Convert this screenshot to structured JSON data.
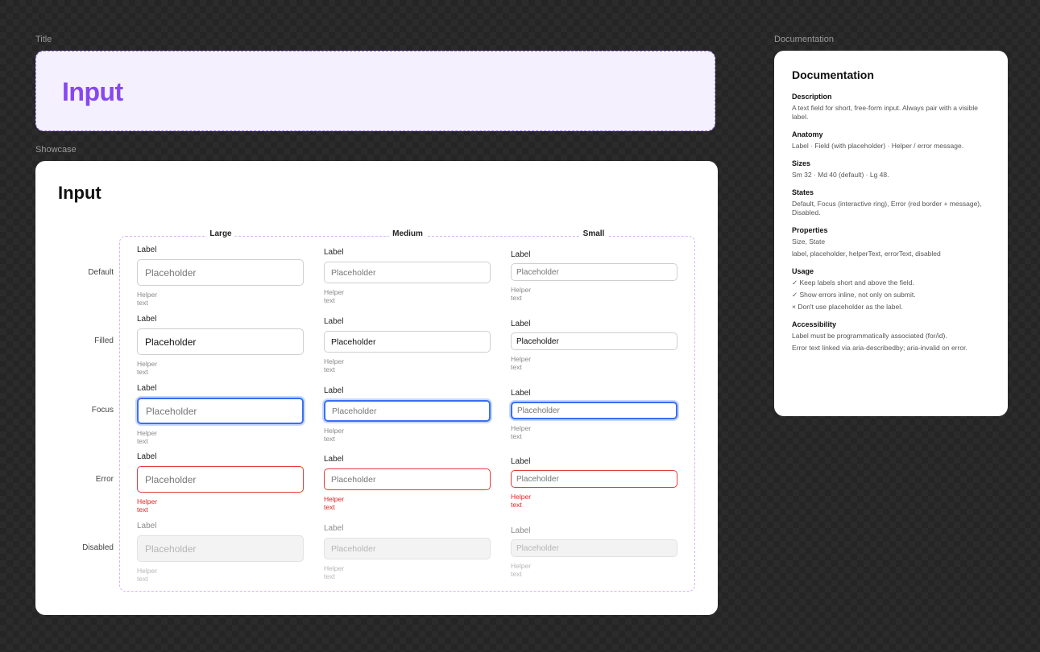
{
  "canvas": {
    "title_frame_label": "Title",
    "showcase_frame_label": "Showcase",
    "doc_frame_label": "Documentation"
  },
  "title": {
    "text": "Input"
  },
  "showcase": {
    "title": "Input",
    "columns": [
      "Large",
      "Medium",
      "Small"
    ],
    "rows": [
      "Default",
      "Filled",
      "Focus",
      "Error",
      "Disabled"
    ],
    "field_label": "Label",
    "placeholder": "Placeholder",
    "helper": "Helper text"
  },
  "doc": {
    "title": "Documentation",
    "sections": [
      {
        "heading": "Description",
        "lines": [
          "A text field for short, free-form input. Always pair with a visible label."
        ]
      },
      {
        "heading": "Anatomy",
        "lines": [
          "Label · Field (with placeholder) · Helper / error message."
        ]
      },
      {
        "heading": "Sizes",
        "lines": [
          "Sm 32 · Md 40 (default) · Lg 48."
        ]
      },
      {
        "heading": "States",
        "lines": [
          "Default, Focus (interactive ring), Error (red border + message), Disabled."
        ]
      },
      {
        "heading": "Properties",
        "lines": [
          "Size, State",
          "label, placeholder, helperText, errorText, disabled"
        ]
      },
      {
        "heading": "Usage",
        "lines": [
          "✓ Keep labels short and above the field.",
          "✓ Show errors inline, not only on submit.",
          "× Don't use placeholder as the label."
        ]
      },
      {
        "heading": "Accessibility",
        "lines": [
          "Label must be programmatically associated (for/id).",
          "Error text linked via aria-describedby; aria-invalid on error."
        ]
      }
    ]
  },
  "colors": {
    "accent": "#8747f0",
    "focus": "#3b6ff2",
    "error": "#e33b3b"
  }
}
